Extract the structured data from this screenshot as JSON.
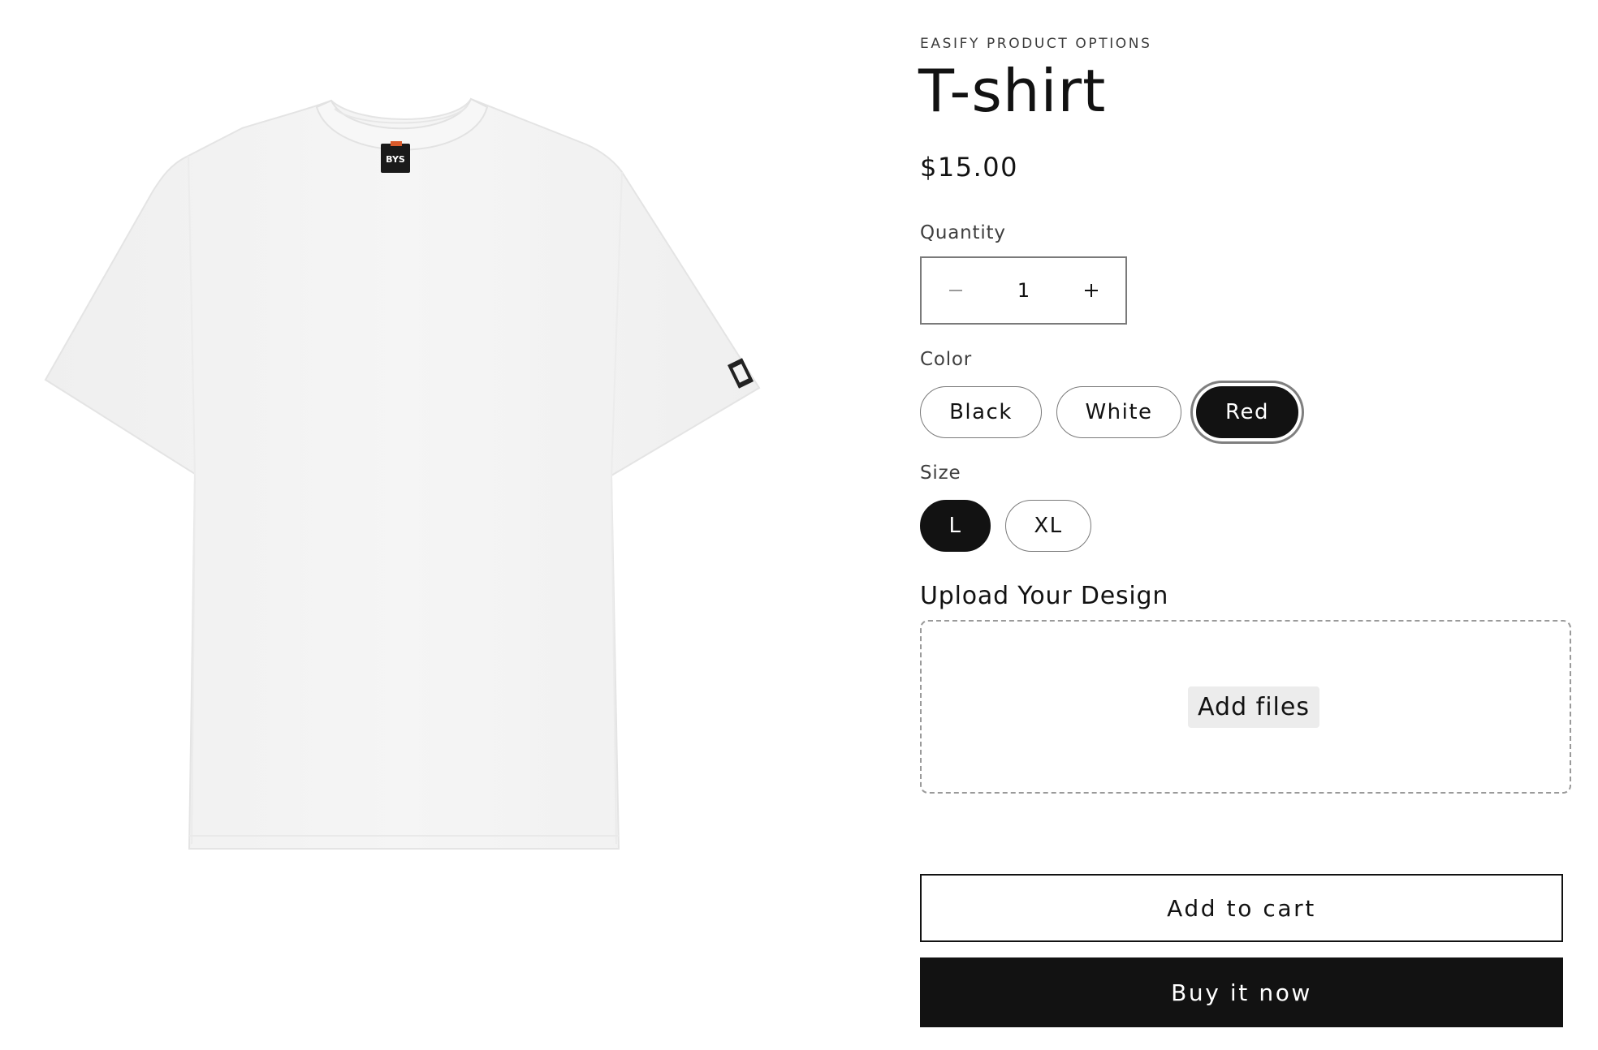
{
  "product": {
    "vendor": "EASIFY PRODUCT OPTIONS",
    "title": "T-shirt",
    "price": "$15.00",
    "image_alt": "White T-shirt",
    "tag_label": "BYS"
  },
  "quantity": {
    "label": "Quantity",
    "value": "1",
    "decrease_icon": "minus-icon",
    "increase_icon": "plus-icon"
  },
  "color": {
    "label": "Color",
    "options": [
      "Black",
      "White",
      "Red"
    ],
    "selected": "Red"
  },
  "size": {
    "label": "Size",
    "options": [
      "L",
      "XL"
    ],
    "selected": "L"
  },
  "upload": {
    "title": "Upload Your Design",
    "button_label": "Add files"
  },
  "actions": {
    "add_to_cart": "Add to cart",
    "buy_now": "Buy it now"
  },
  "colors": {
    "primary": "#121212",
    "background": "#ffffff",
    "muted_text": "#3f3f3f",
    "border": "#7a7a7a",
    "upload_button_bg": "#ececec"
  }
}
